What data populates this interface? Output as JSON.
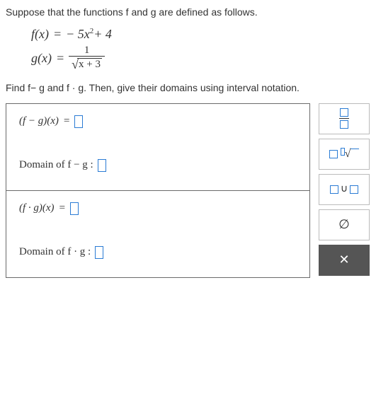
{
  "prompt": {
    "intro": "Suppose that the functions f and g are defined as follows.",
    "f_lhs": "f(x)",
    "eq": " = ",
    "f_rhs_a": "− 5x",
    "f_rhs_exp": "2",
    "f_rhs_b": "+ 4",
    "g_lhs": "g(x)",
    "g_frac_num": "1",
    "g_frac_den_inner": "x + 3",
    "instruction": "Find f− g and f · g. Then, give their domains using interval notation."
  },
  "answers": {
    "row1_label_a": "(f − g)(x)",
    "eq": " = ",
    "row2_label": "Domain of f − g  :",
    "row3_label_a": "(f · g)(x)",
    "row4_label": "Domain of f · g  :"
  },
  "palette": {
    "empty_icon": "∅",
    "union_sym": "∪",
    "close": "✕",
    "sqrt": "√"
  }
}
